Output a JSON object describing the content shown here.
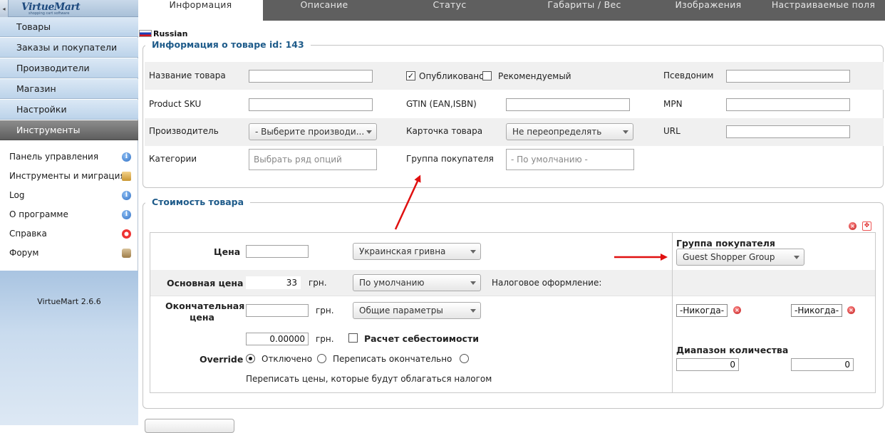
{
  "sidebar": {
    "logo_text": "VirtueMart",
    "logo_sub": "shopping cart software",
    "collapse_glyph": "◂",
    "menu": [
      "Товары",
      "Заказы и покупатели",
      "Производители",
      "Магазин",
      "Настройки",
      "Инструменты"
    ],
    "active_menu": "Инструменты",
    "sub_items": [
      {
        "label": "Панель управления",
        "icon": "info-icon"
      },
      {
        "label": "Инструменты и миграция",
        "icon": "package-icon"
      },
      {
        "label": "Log",
        "icon": "info-icon"
      },
      {
        "label": "О программе",
        "icon": "info-icon"
      },
      {
        "label": "Справка",
        "icon": "lifebuoy-icon"
      },
      {
        "label": "Форум",
        "icon": "users-icon"
      }
    ],
    "version": "VirtueMart 2.6.6"
  },
  "tabs": [
    "Информация",
    "Описание",
    "Статус",
    "Габариты / Вес",
    "Изображения",
    "Настраиваемые поля"
  ],
  "active_tab": "Информация",
  "language": "Russian",
  "product_info": {
    "legend": "Информация о товаре id: 143",
    "name_label": "Название товара",
    "name_value": "",
    "published_label": "Опубликовано",
    "published_checked": true,
    "featured_label": "Рекомендуемый",
    "featured_checked": false,
    "alias_label": "Псевдоним",
    "sku_label": "Product SKU",
    "gtin_label": "GTIN (EAN,ISBN)",
    "mpn_label": "MPN",
    "manufacturer_label": "Производитель",
    "manufacturer_value": "- Выберите производи...",
    "card_label": "Карточка товара",
    "card_value": "Не переопределять",
    "url_label": "URL",
    "categories_label": "Категории",
    "categories_placeholder": "Выбрать ряд опций",
    "shopper_group_label": "Группа покупателя",
    "shopper_group_placeholder": "- По умолчанию -"
  },
  "pricing": {
    "legend": "Стоимость товара",
    "price_label": "Цена",
    "price_value": "",
    "currency": "Украинская гривна",
    "base_price_label": "Основная цена",
    "base_price_value": "33",
    "currency_unit": "грн.",
    "tax_rule": "По умолчанию",
    "tax_label": "Налоговое оформление:",
    "final_price_label_1": "Окончательная",
    "final_price_label_2": "цена",
    "final_price_value": "",
    "discount_rule": "Общие параметры",
    "override_value": "0.00000",
    "cost_calc_label": "Расчет себестоимости",
    "cost_calc_checked": false,
    "override_label": "Override",
    "override_options": [
      "Отключено",
      "Переписать окончательно"
    ],
    "override_note": "Переписать цены, которые будут облагаться налогом",
    "shopper_group_title": "Группа покупателя",
    "shopper_group_value": "Guest Shopper Group",
    "date_from": "-Никогда-",
    "date_to": "-Никогда-",
    "quantity_range_label": "Диапазон количества",
    "qty_from": "0",
    "qty_to": "0"
  },
  "colors": {
    "legend_blue": "#1e5b8a",
    "tab_bar": "#5f5f5f",
    "arrow_red": "#e01010"
  }
}
